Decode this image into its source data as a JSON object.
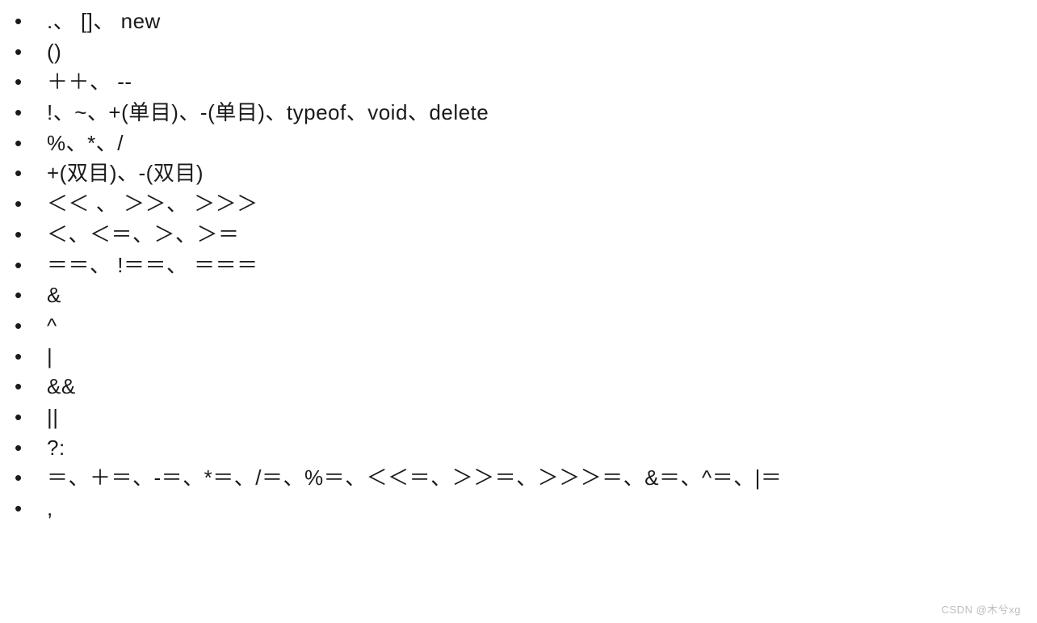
{
  "operator_precedence": {
    "items": [
      ".、 []、 new",
      "()",
      "＋＋、 --",
      "!、~、+(单目)、-(单目)、typeof、void、delete",
      "%、*、/",
      "+(双目)、-(双目)",
      "＜＜ 、 ＞＞、 ＞＞＞",
      "＜、＜＝、＞、＞＝",
      "＝＝、 !＝＝、 ＝＝＝",
      "&",
      "^",
      "|",
      "&&",
      "||",
      "?:",
      "＝、＋＝、-＝、*＝、/＝、%＝、＜＜＝、＞＞＝、＞＞＞＝、&＝、^＝、|＝",
      ","
    ]
  },
  "watermark": "CSDN @木兮xg"
}
